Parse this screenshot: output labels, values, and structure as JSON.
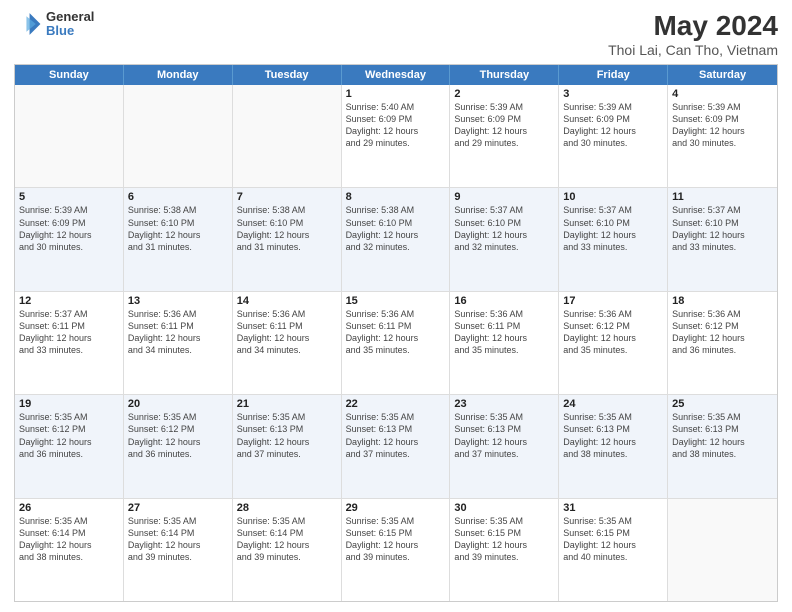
{
  "header": {
    "logo_line1": "General",
    "logo_line2": "Blue",
    "month_year": "May 2024",
    "location": "Thoi Lai, Can Tho, Vietnam"
  },
  "days_of_week": [
    "Sunday",
    "Monday",
    "Tuesday",
    "Wednesday",
    "Thursday",
    "Friday",
    "Saturday"
  ],
  "rows": [
    {
      "cells": [
        {
          "day": "",
          "empty": true
        },
        {
          "day": "",
          "empty": true
        },
        {
          "day": "",
          "empty": true
        },
        {
          "day": "1",
          "sunrise": "5:40 AM",
          "sunset": "6:09 PM",
          "daylight": "12 hours and 29 minutes."
        },
        {
          "day": "2",
          "sunrise": "5:39 AM",
          "sunset": "6:09 PM",
          "daylight": "12 hours and 29 minutes."
        },
        {
          "day": "3",
          "sunrise": "5:39 AM",
          "sunset": "6:09 PM",
          "daylight": "12 hours and 30 minutes."
        },
        {
          "day": "4",
          "sunrise": "5:39 AM",
          "sunset": "6:09 PM",
          "daylight": "12 hours and 30 minutes."
        }
      ]
    },
    {
      "cells": [
        {
          "day": "5",
          "sunrise": "5:39 AM",
          "sunset": "6:09 PM",
          "daylight": "12 hours and 30 minutes."
        },
        {
          "day": "6",
          "sunrise": "5:38 AM",
          "sunset": "6:10 PM",
          "daylight": "12 hours and 31 minutes."
        },
        {
          "day": "7",
          "sunrise": "5:38 AM",
          "sunset": "6:10 PM",
          "daylight": "12 hours and 31 minutes."
        },
        {
          "day": "8",
          "sunrise": "5:38 AM",
          "sunset": "6:10 PM",
          "daylight": "12 hours and 32 minutes."
        },
        {
          "day": "9",
          "sunrise": "5:37 AM",
          "sunset": "6:10 PM",
          "daylight": "12 hours and 32 minutes."
        },
        {
          "day": "10",
          "sunrise": "5:37 AM",
          "sunset": "6:10 PM",
          "daylight": "12 hours and 33 minutes."
        },
        {
          "day": "11",
          "sunrise": "5:37 AM",
          "sunset": "6:10 PM",
          "daylight": "12 hours and 33 minutes."
        }
      ]
    },
    {
      "cells": [
        {
          "day": "12",
          "sunrise": "5:37 AM",
          "sunset": "6:11 PM",
          "daylight": "12 hours and 33 minutes."
        },
        {
          "day": "13",
          "sunrise": "5:36 AM",
          "sunset": "6:11 PM",
          "daylight": "12 hours and 34 minutes."
        },
        {
          "day": "14",
          "sunrise": "5:36 AM",
          "sunset": "6:11 PM",
          "daylight": "12 hours and 34 minutes."
        },
        {
          "day": "15",
          "sunrise": "5:36 AM",
          "sunset": "6:11 PM",
          "daylight": "12 hours and 35 minutes."
        },
        {
          "day": "16",
          "sunrise": "5:36 AM",
          "sunset": "6:11 PM",
          "daylight": "12 hours and 35 minutes."
        },
        {
          "day": "17",
          "sunrise": "5:36 AM",
          "sunset": "6:12 PM",
          "daylight": "12 hours and 35 minutes."
        },
        {
          "day": "18",
          "sunrise": "5:36 AM",
          "sunset": "6:12 PM",
          "daylight": "12 hours and 36 minutes."
        }
      ]
    },
    {
      "cells": [
        {
          "day": "19",
          "sunrise": "5:35 AM",
          "sunset": "6:12 PM",
          "daylight": "12 hours and 36 minutes."
        },
        {
          "day": "20",
          "sunrise": "5:35 AM",
          "sunset": "6:12 PM",
          "daylight": "12 hours and 36 minutes."
        },
        {
          "day": "21",
          "sunrise": "5:35 AM",
          "sunset": "6:13 PM",
          "daylight": "12 hours and 37 minutes."
        },
        {
          "day": "22",
          "sunrise": "5:35 AM",
          "sunset": "6:13 PM",
          "daylight": "12 hours and 37 minutes."
        },
        {
          "day": "23",
          "sunrise": "5:35 AM",
          "sunset": "6:13 PM",
          "daylight": "12 hours and 37 minutes."
        },
        {
          "day": "24",
          "sunrise": "5:35 AM",
          "sunset": "6:13 PM",
          "daylight": "12 hours and 38 minutes."
        },
        {
          "day": "25",
          "sunrise": "5:35 AM",
          "sunset": "6:13 PM",
          "daylight": "12 hours and 38 minutes."
        }
      ]
    },
    {
      "cells": [
        {
          "day": "26",
          "sunrise": "5:35 AM",
          "sunset": "6:14 PM",
          "daylight": "12 hours and 38 minutes."
        },
        {
          "day": "27",
          "sunrise": "5:35 AM",
          "sunset": "6:14 PM",
          "daylight": "12 hours and 39 minutes."
        },
        {
          "day": "28",
          "sunrise": "5:35 AM",
          "sunset": "6:14 PM",
          "daylight": "12 hours and 39 minutes."
        },
        {
          "day": "29",
          "sunrise": "5:35 AM",
          "sunset": "6:15 PM",
          "daylight": "12 hours and 39 minutes."
        },
        {
          "day": "30",
          "sunrise": "5:35 AM",
          "sunset": "6:15 PM",
          "daylight": "12 hours and 39 minutes."
        },
        {
          "day": "31",
          "sunrise": "5:35 AM",
          "sunset": "6:15 PM",
          "daylight": "12 hours and 40 minutes."
        },
        {
          "day": "",
          "empty": true
        }
      ]
    }
  ]
}
